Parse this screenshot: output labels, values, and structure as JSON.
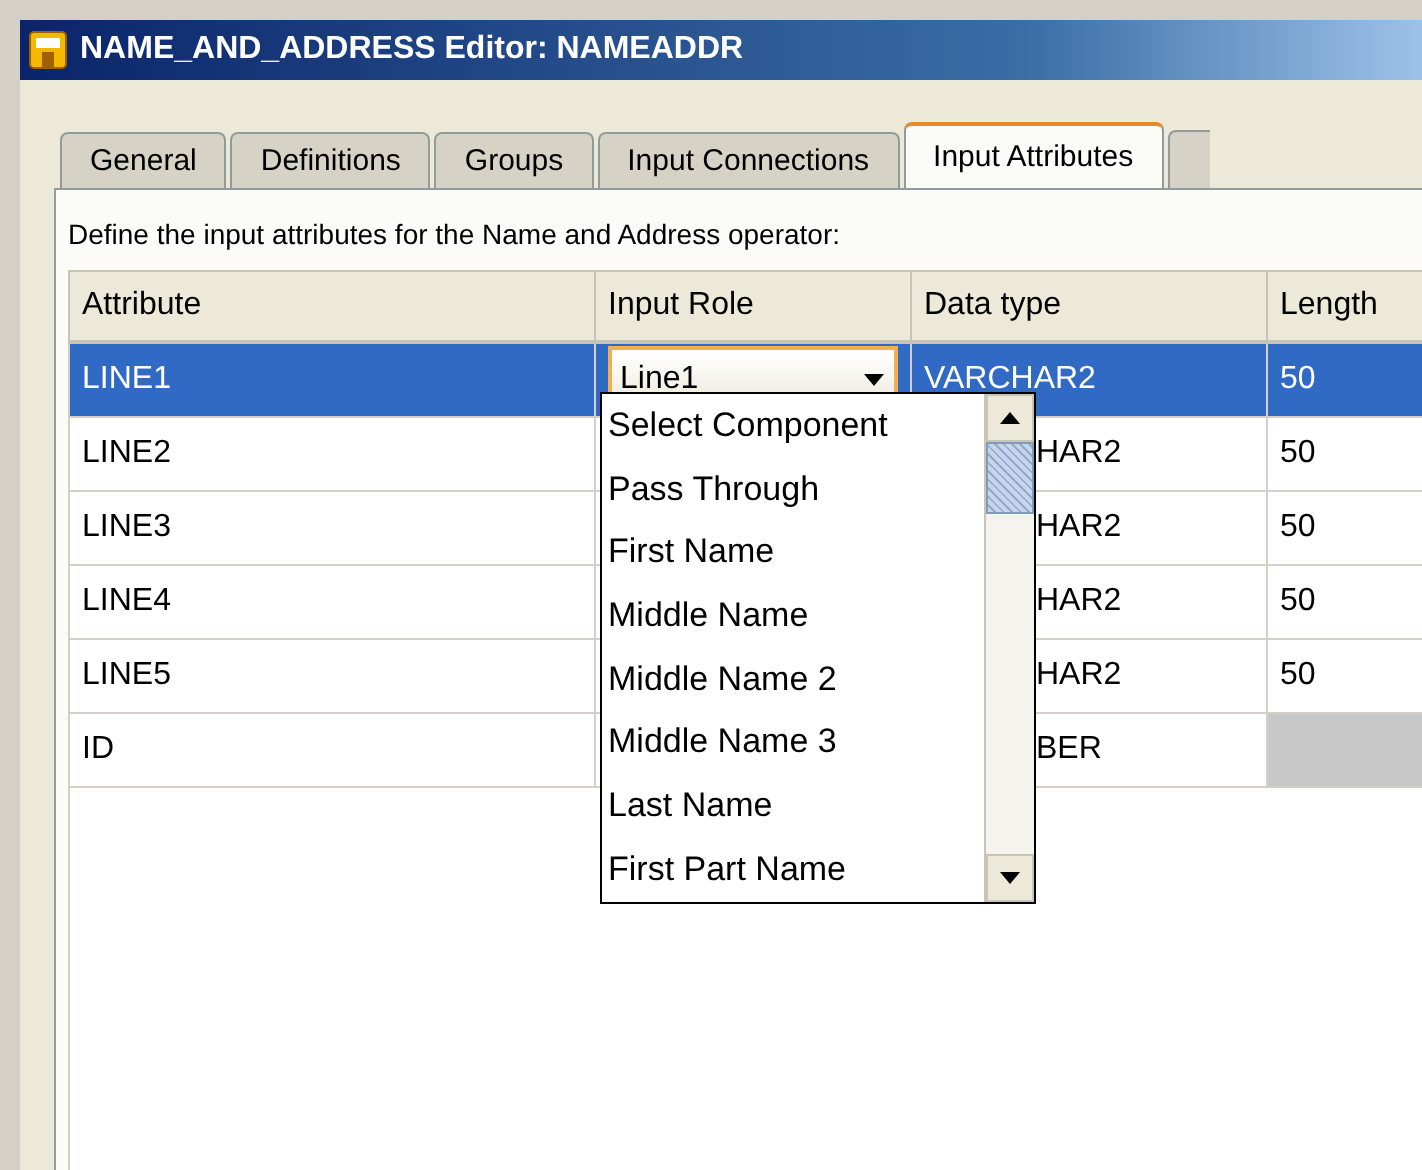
{
  "window": {
    "title": "NAME_AND_ADDRESS Editor: NAMEADDR"
  },
  "tabs": [
    {
      "label": "General",
      "selected": false
    },
    {
      "label": "Definitions",
      "selected": false
    },
    {
      "label": "Groups",
      "selected": false
    },
    {
      "label": "Input Connections",
      "selected": false
    },
    {
      "label": "Input Attributes",
      "selected": true
    }
  ],
  "description": "Define the input attributes for the Name and Address operator:",
  "table": {
    "columns": [
      "Attribute",
      "Input Role",
      "Data type",
      "Length"
    ],
    "rows": [
      {
        "attribute": "LINE1",
        "input_role": "Line1",
        "data_type": "VARCHAR2",
        "length": "50",
        "selected": true,
        "length_editable": true
      },
      {
        "attribute": "LINE2",
        "data_type": "HAR2",
        "length": "50",
        "selected": false,
        "length_editable": true
      },
      {
        "attribute": "LINE3",
        "data_type": "HAR2",
        "length": "50",
        "selected": false,
        "length_editable": true
      },
      {
        "attribute": "LINE4",
        "data_type": "HAR2",
        "length": "50",
        "selected": false,
        "length_editable": true
      },
      {
        "attribute": "LINE5",
        "data_type": "HAR2",
        "length": "50",
        "selected": false,
        "length_editable": true
      },
      {
        "attribute": "ID",
        "data_type": "BER",
        "selected": false,
        "length_editable": false
      }
    ]
  },
  "dropdown": {
    "options": [
      "Select Component",
      "Pass Through",
      "First Name",
      "Middle Name",
      "Middle Name 2",
      "Middle Name 3",
      "Last Name",
      "First Part Name"
    ]
  }
}
